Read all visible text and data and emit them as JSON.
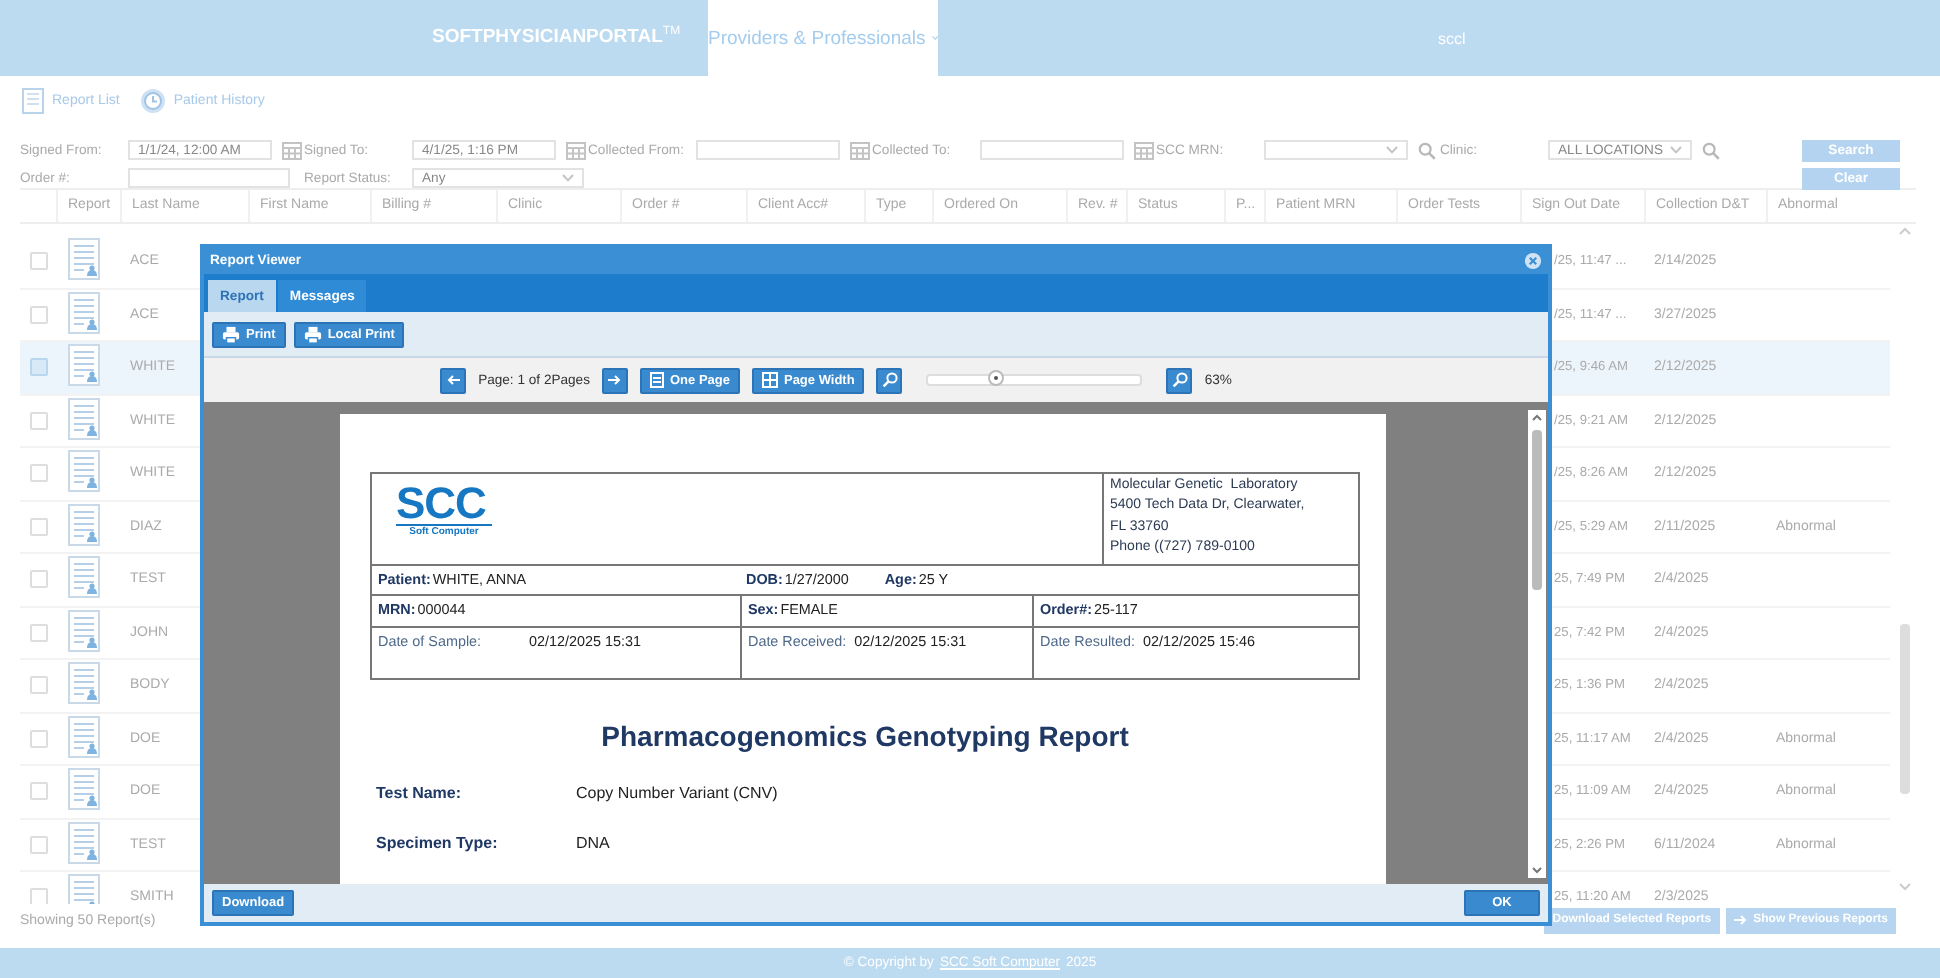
{
  "header": {
    "brand": "SOFTPHYSICIANPORTAL$^{TM}$",
    "menu": {
      "label": "Providers & Professionals",
      "selected": true
    },
    "user": "sccl"
  },
  "nav": [
    {
      "label": "Report List",
      "kind": "list"
    },
    {
      "label": "Patient History",
      "kind": "history"
    }
  ],
  "filters": [
    {
      "label": "Signed From:",
      "kind": "date",
      "value": "1/1/24, 12:00 AM"
    },
    {
      "label": "Signed To:",
      "kind": "date",
      "value": "4/1/25, 1:16 PM"
    },
    {
      "label": "Collected From:",
      "kind": "date"
    },
    {
      "label": "Collected To:",
      "kind": "date"
    },
    {
      "label": "SCC MRN:",
      "kind": "lookup"
    },
    {
      "label": "Clinic:",
      "kind": "lookup",
      "value": "ALL LOCATIONS"
    }
  ],
  "filters_2": [
    {
      "label": "Order #:",
      "kind": "text"
    },
    {
      "label": "Report Status:",
      "kind": "select",
      "value": "Any"
    }
  ],
  "filter_buttons": [
    "Search",
    "Clear"
  ],
  "table": {
    "columns": [
      "Report",
      "Last Name",
      "First Name",
      "Billing #",
      "Clinic",
      "Order #",
      "Client Acc#",
      "Type",
      "Ordered On",
      "Rev. #",
      "Status",
      "P...",
      "Patient MRN",
      "Order Tests",
      "Sign Out Date",
      "Collection D&T",
      "Abnormal"
    ],
    "rows": [
      {
        "last_name": "ACE",
        "sign_out": "/25, 11:47 ...",
        "collection": "2/14/2025",
        "selected": false
      },
      {
        "last_name": "ACE",
        "sign_out": "/25, 11:47 ...",
        "collection": "3/27/2025",
        "selected": false
      },
      {
        "last_name": "WHITE",
        "sign_out": "/25, 9:46 AM",
        "collection": "2/12/2025",
        "selected": true
      },
      {
        "last_name": "WHITE",
        "sign_out": "/25, 9:21 AM",
        "collection": "2/12/2025",
        "selected": false
      },
      {
        "last_name": "WHITE",
        "sign_out": "/25, 8:26 AM",
        "collection": "2/12/2025",
        "selected": false
      },
      {
        "last_name": "DIAZ",
        "sign_out": "/25, 5:29 AM",
        "collection": "2/11/2025",
        "abnormal": "Abnormal",
        "selected": false
      },
      {
        "last_name": "TEST",
        "sign_out": "25, 7:49 PM",
        "collection": "2/4/2025",
        "selected": false
      },
      {
        "last_name": "JOHN",
        "sign_out": "25, 7:42 PM",
        "collection": "2/4/2025",
        "selected": false
      },
      {
        "last_name": "BODY",
        "sign_out": "25, 1:36 PM",
        "collection": "2/4/2025",
        "selected": false
      },
      {
        "last_name": "DOE",
        "sign_out": "25, 11:17 AM",
        "collection": "2/4/2025",
        "abnormal": "Abnormal",
        "selected": false
      },
      {
        "last_name": "DOE",
        "sign_out": "25, 11:09 AM",
        "collection": "2/4/2025",
        "abnormal": "Abnormal",
        "selected": false
      },
      {
        "last_name": "TEST",
        "sign_out": "25, 2:26 PM",
        "collection": "6/11/2024",
        "abnormal": "Abnormal",
        "selected": false
      },
      {
        "last_name": "SMITH",
        "sign_out": "25, 11:20 AM",
        "collection": "2/3/2025",
        "selected": false
      }
    ]
  },
  "status": "Showing 50 Report(s)",
  "footer_buttons": [
    "Download Selected Reports",
    "Show Previous Reports"
  ],
  "copyright": {
    "before": "© Copyright by",
    "link": "SCC Soft Computer",
    "after": "2025"
  },
  "viewer": {
    "title": "Report Viewer",
    "tabs": [
      {
        "label": "Report",
        "selected": true
      },
      {
        "label": "Messages",
        "selected": false
      }
    ],
    "actions": [
      "Print",
      "Local Print"
    ],
    "pager": "Page: 1 of 2Pages",
    "view_buttons": [
      "One Page",
      "Page Width"
    ],
    "zoom": {
      "level": 0.32,
      "reading": "63%"
    },
    "footer_buttons": [
      "Download",
      "OK"
    ]
  },
  "document": {
    "logo": {
      "name": "SCC",
      "tagline": "Soft Computer"
    },
    "lab": [
      "Molecular Genetic  Laboratory",
      "5400 Tech Data Dr, Clearwater,",
      "FL 33760",
      "Phone ((727) 789-0100"
    ],
    "info_rows": [
      {
        "divided": false,
        "cells": [
          [
            {
              "label": "Patient:",
              "value": "WHITE, ANNA",
              "kind": "bold"
            }
          ],
          [
            {
              "label": "DOB:",
              "value": "1/27/2000",
              "kind": "bold"
            },
            {
              "label": "Age:",
              "value": "25 Y",
              "kind": "bold"
            }
          ]
        ]
      },
      {
        "divided": true,
        "cells": [
          [
            {
              "label": "MRN:",
              "value": "000044",
              "kind": "bold"
            }
          ],
          [
            {
              "label": "Sex:",
              "value": "FEMALE",
              "kind": "bold"
            }
          ],
          [
            {
              "label": "Order#:",
              "value": "25-117",
              "kind": "bold"
            }
          ]
        ]
      },
      {
        "divided": true,
        "cells": [
          [
            {
              "label": "Date of Sample:",
              "value": "02/12/2025 15:31",
              "kind": "light"
            }
          ],
          [
            {
              "label": "Date Received:",
              "value": "02/12/2025 15:31",
              "kind": "light"
            }
          ],
          [
            {
              "label": "Date Resulted:",
              "value": "02/12/2025 15:46",
              "kind": "light"
            }
          ]
        ]
      }
    ],
    "title": "Pharmacogenomics Genotyping Report",
    "fields": [
      {
        "label": "Test Name:",
        "value": "Copy Number Variant (CNV)"
      },
      {
        "label": "Specimen Type:",
        "value": "DNA"
      }
    ]
  }
}
